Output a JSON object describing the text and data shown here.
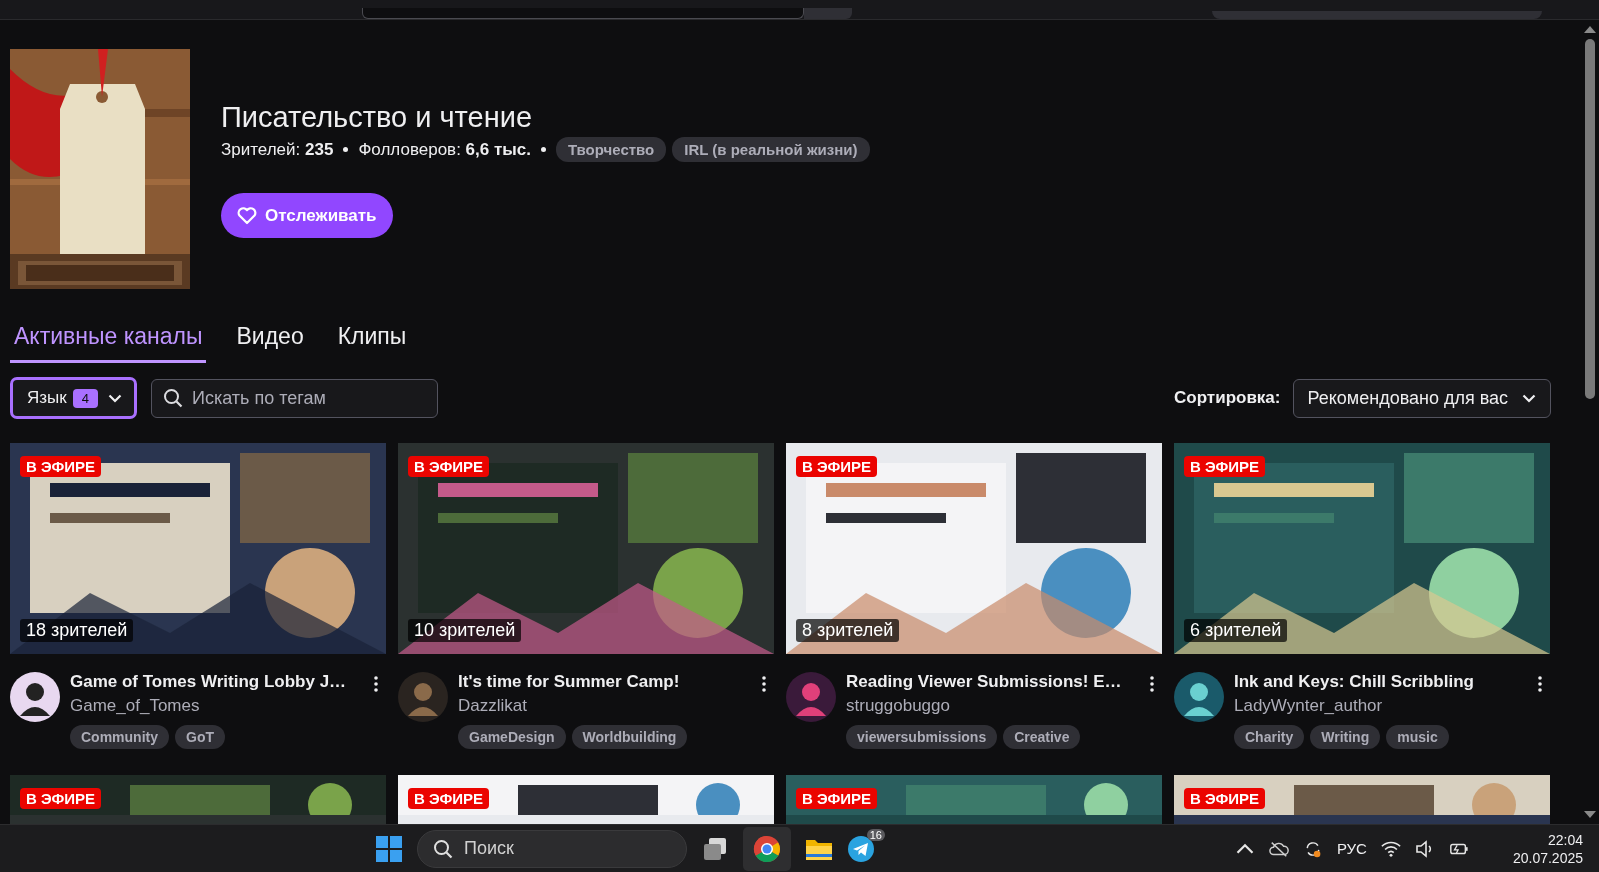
{
  "category": {
    "title": "Писательство и чтение",
    "viewers_label": "Зрителей:",
    "viewers": "235",
    "followers_label": "Фолловеров:",
    "followers": "6,6 тыс.",
    "tags": [
      "Творчество",
      "IRL (в реальной жизни)"
    ],
    "follow_button": "Отслеживать"
  },
  "tabs": [
    {
      "label": "Активные каналы",
      "selected": true
    },
    {
      "label": "Видео",
      "selected": false
    },
    {
      "label": "Клипы",
      "selected": false
    }
  ],
  "filters": {
    "language": {
      "label": "Язык",
      "count": "4"
    },
    "tag_search": {
      "placeholder": "Искать по тегам"
    },
    "sort": {
      "label": "Сортировка:",
      "value": "Рекомендовано для вас"
    }
  },
  "streams": [
    {
      "live_badge": "В ЭФИРЕ",
      "viewers": "18 зрителей",
      "title": "Game of Tomes Writing Lobby J…",
      "channel": "Game_of_Tomes",
      "tags": [
        "Community",
        "GoT"
      ]
    },
    {
      "live_badge": "В ЭФИРЕ",
      "viewers": "10 зрителей",
      "title": "It's time for Summer Camp!",
      "channel": "Dazzlikat",
      "tags": [
        "GameDesign",
        "Worldbuilding"
      ]
    },
    {
      "live_badge": "В ЭФИРЕ",
      "viewers": "8 зрителей",
      "title": "Reading Viewer Submissions! E…",
      "channel": "struggobuggo",
      "tags": [
        "viewersubmissions",
        "Creative"
      ]
    },
    {
      "live_badge": "В ЭФИРЕ",
      "viewers": "6 зрителей",
      "title": "Ink and Keys: Chill Scribbling",
      "channel": "LadyWynter_author",
      "tags": [
        "Charity",
        "Writing",
        "music"
      ]
    }
  ],
  "more_streams": [
    {
      "live_badge": "В ЭФИРЕ"
    },
    {
      "live_badge": "В ЭФИРЕ"
    },
    {
      "live_badge": "В ЭФИРЕ"
    },
    {
      "live_badge": "В ЭФИРЕ"
    }
  ],
  "taskbar": {
    "search_placeholder": "Поиск",
    "telegram_badge": "16",
    "language": "РУС",
    "time": "22:04",
    "date": "20.07.2025"
  }
}
